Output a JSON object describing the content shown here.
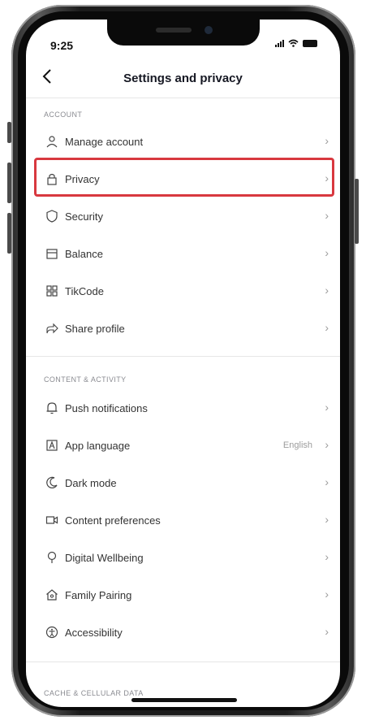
{
  "status_bar": {
    "time": "9:25"
  },
  "header": {
    "back_icon": "chevron-left-icon",
    "title": "Settings and privacy"
  },
  "sections": {
    "account": "ACCOUNT",
    "content": "CONTENT & ACTIVITY",
    "cache": "CACHE & CELLULAR DATA"
  },
  "account_items": [
    {
      "label": "Manage account",
      "icon": "person-icon"
    },
    {
      "label": "Privacy",
      "icon": "lock-icon"
    },
    {
      "label": "Security",
      "icon": "shield-icon"
    },
    {
      "label": "Balance",
      "icon": "wallet-icon"
    },
    {
      "label": "TikCode",
      "icon": "qr-code-icon"
    },
    {
      "label": "Share profile",
      "icon": "share-icon"
    }
  ],
  "content_items": [
    {
      "label": "Push notifications",
      "icon": "bell-icon"
    },
    {
      "label": "App language",
      "icon": "language-icon",
      "value": "English"
    },
    {
      "label": "Dark mode",
      "icon": "moon-icon"
    },
    {
      "label": "Content preferences",
      "icon": "video-icon"
    },
    {
      "label": "Digital Wellbeing",
      "icon": "wellbeing-icon"
    },
    {
      "label": "Family Pairing",
      "icon": "home-icon"
    },
    {
      "label": "Accessibility",
      "icon": "accessibility-icon"
    }
  ],
  "chevron": "›",
  "highlight_color": "#d8383f"
}
